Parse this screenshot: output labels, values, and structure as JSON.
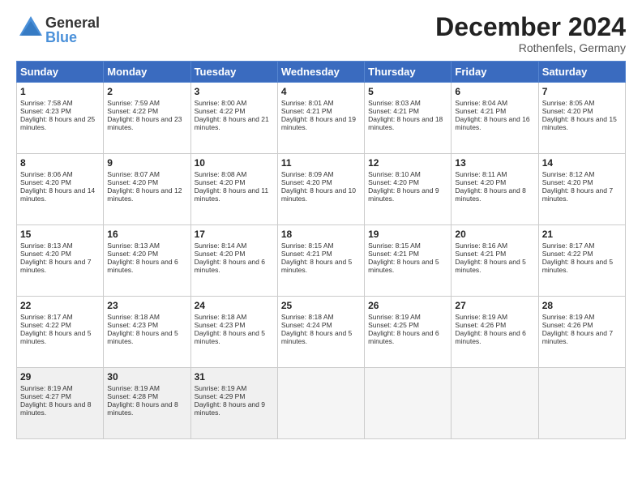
{
  "header": {
    "logo_general": "General",
    "logo_blue": "Blue",
    "title": "December 2024",
    "location": "Rothenfels, Germany"
  },
  "days_of_week": [
    "Sunday",
    "Monday",
    "Tuesday",
    "Wednesday",
    "Thursday",
    "Friday",
    "Saturday"
  ],
  "weeks": [
    [
      {
        "day": "1",
        "sunrise": "7:58 AM",
        "sunset": "4:23 PM",
        "daylight": "8 hours and 25 minutes."
      },
      {
        "day": "2",
        "sunrise": "7:59 AM",
        "sunset": "4:22 PM",
        "daylight": "8 hours and 23 minutes."
      },
      {
        "day": "3",
        "sunrise": "8:00 AM",
        "sunset": "4:22 PM",
        "daylight": "8 hours and 21 minutes."
      },
      {
        "day": "4",
        "sunrise": "8:01 AM",
        "sunset": "4:21 PM",
        "daylight": "8 hours and 19 minutes."
      },
      {
        "day": "5",
        "sunrise": "8:03 AM",
        "sunset": "4:21 PM",
        "daylight": "8 hours and 18 minutes."
      },
      {
        "day": "6",
        "sunrise": "8:04 AM",
        "sunset": "4:21 PM",
        "daylight": "8 hours and 16 minutes."
      },
      {
        "day": "7",
        "sunrise": "8:05 AM",
        "sunset": "4:20 PM",
        "daylight": "8 hours and 15 minutes."
      }
    ],
    [
      {
        "day": "8",
        "sunrise": "8:06 AM",
        "sunset": "4:20 PM",
        "daylight": "8 hours and 14 minutes."
      },
      {
        "day": "9",
        "sunrise": "8:07 AM",
        "sunset": "4:20 PM",
        "daylight": "8 hours and 12 minutes."
      },
      {
        "day": "10",
        "sunrise": "8:08 AM",
        "sunset": "4:20 PM",
        "daylight": "8 hours and 11 minutes."
      },
      {
        "day": "11",
        "sunrise": "8:09 AM",
        "sunset": "4:20 PM",
        "daylight": "8 hours and 10 minutes."
      },
      {
        "day": "12",
        "sunrise": "8:10 AM",
        "sunset": "4:20 PM",
        "daylight": "8 hours and 9 minutes."
      },
      {
        "day": "13",
        "sunrise": "8:11 AM",
        "sunset": "4:20 PM",
        "daylight": "8 hours and 8 minutes."
      },
      {
        "day": "14",
        "sunrise": "8:12 AM",
        "sunset": "4:20 PM",
        "daylight": "8 hours and 7 minutes."
      }
    ],
    [
      {
        "day": "15",
        "sunrise": "8:13 AM",
        "sunset": "4:20 PM",
        "daylight": "8 hours and 7 minutes."
      },
      {
        "day": "16",
        "sunrise": "8:13 AM",
        "sunset": "4:20 PM",
        "daylight": "8 hours and 6 minutes."
      },
      {
        "day": "17",
        "sunrise": "8:14 AM",
        "sunset": "4:20 PM",
        "daylight": "8 hours and 6 minutes."
      },
      {
        "day": "18",
        "sunrise": "8:15 AM",
        "sunset": "4:21 PM",
        "daylight": "8 hours and 5 minutes."
      },
      {
        "day": "19",
        "sunrise": "8:15 AM",
        "sunset": "4:21 PM",
        "daylight": "8 hours and 5 minutes."
      },
      {
        "day": "20",
        "sunrise": "8:16 AM",
        "sunset": "4:21 PM",
        "daylight": "8 hours and 5 minutes."
      },
      {
        "day": "21",
        "sunrise": "8:17 AM",
        "sunset": "4:22 PM",
        "daylight": "8 hours and 5 minutes."
      }
    ],
    [
      {
        "day": "22",
        "sunrise": "8:17 AM",
        "sunset": "4:22 PM",
        "daylight": "8 hours and 5 minutes."
      },
      {
        "day": "23",
        "sunrise": "8:18 AM",
        "sunset": "4:23 PM",
        "daylight": "8 hours and 5 minutes."
      },
      {
        "day": "24",
        "sunrise": "8:18 AM",
        "sunset": "4:23 PM",
        "daylight": "8 hours and 5 minutes."
      },
      {
        "day": "25",
        "sunrise": "8:18 AM",
        "sunset": "4:24 PM",
        "daylight": "8 hours and 5 minutes."
      },
      {
        "day": "26",
        "sunrise": "8:19 AM",
        "sunset": "4:25 PM",
        "daylight": "8 hours and 6 minutes."
      },
      {
        "day": "27",
        "sunrise": "8:19 AM",
        "sunset": "4:26 PM",
        "daylight": "8 hours and 6 minutes."
      },
      {
        "day": "28",
        "sunrise": "8:19 AM",
        "sunset": "4:26 PM",
        "daylight": "8 hours and 7 minutes."
      }
    ],
    [
      {
        "day": "29",
        "sunrise": "8:19 AM",
        "sunset": "4:27 PM",
        "daylight": "8 hours and 8 minutes."
      },
      {
        "day": "30",
        "sunrise": "8:19 AM",
        "sunset": "4:28 PM",
        "daylight": "8 hours and 8 minutes."
      },
      {
        "day": "31",
        "sunrise": "8:19 AM",
        "sunset": "4:29 PM",
        "daylight": "8 hours and 9 minutes."
      },
      null,
      null,
      null,
      null
    ]
  ]
}
